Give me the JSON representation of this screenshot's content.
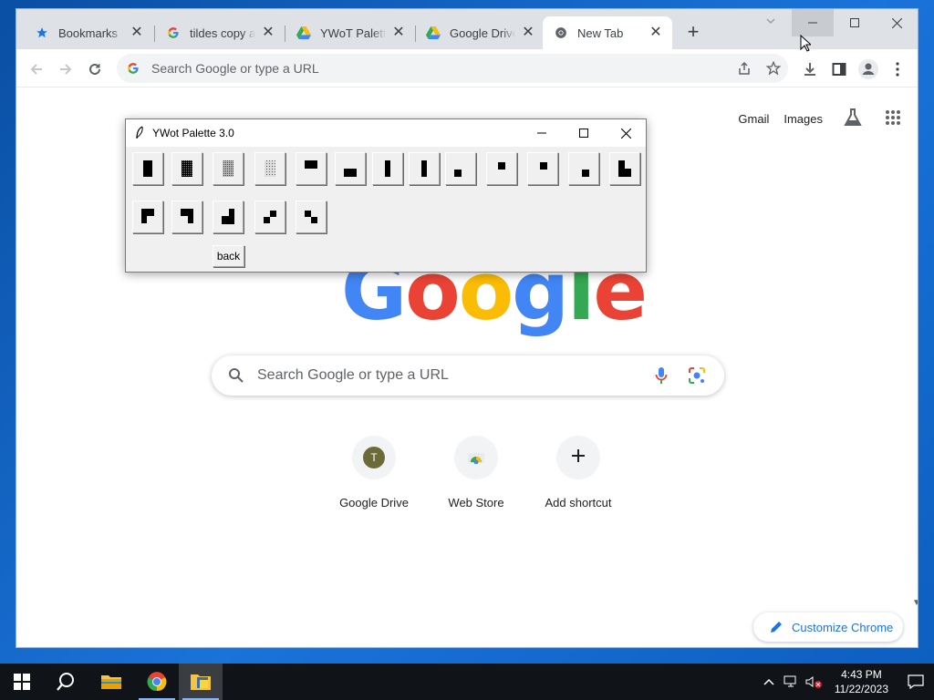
{
  "browser": {
    "tabs": [
      {
        "label": "Bookmarks",
        "icon": "star-icon",
        "active": false
      },
      {
        "label": "tildes copy and",
        "icon": "google-g-icon",
        "active": false
      },
      {
        "label": "YWoT Palette",
        "icon": "google-drive-icon",
        "active": false
      },
      {
        "label": "Google Drive",
        "icon": "google-drive-icon",
        "active": false
      },
      {
        "label": "New Tab",
        "icon": "chrome-icon",
        "active": true
      }
    ],
    "omnibox_placeholder": "Search Google or type a URL"
  },
  "ntp": {
    "gmail_label": "Gmail",
    "images_label": "Images",
    "logo_letters": [
      "G",
      "o",
      "o",
      "g",
      "l",
      "e"
    ],
    "logo_colors": [
      "#4285f4",
      "#ea4335",
      "#fbbc05",
      "#4285f4",
      "#34a853",
      "#ea4335"
    ],
    "search_placeholder": "Search Google or type a URL",
    "shortcuts": [
      {
        "label": "Google Drive",
        "icon_letter": "T",
        "icon_color": "#6b6b3a"
      },
      {
        "label": "Web Store",
        "icon": "web-store-icon"
      },
      {
        "label": "Add shortcut",
        "icon": "plus-icon"
      }
    ],
    "customize_label": "Customize Chrome"
  },
  "palette": {
    "title": "YWot Palette 3.0",
    "row1_glyphs": [
      "full-block",
      "dark-shade",
      "medium-shade",
      "light-shade",
      "upper-half",
      "lower-half",
      "left-bar",
      "right-bar",
      "lower-left-quad",
      "upper-left-quad",
      "upper-right-quad",
      "lower-right-quad",
      "three-quad-l"
    ],
    "row2_glyphs": [
      "three-quad-tl",
      "three-quad-tr",
      "three-quad-br",
      "diagonal-up",
      "diagonal-down"
    ],
    "back_label": "back"
  },
  "taskbar": {
    "time": "4:43 PM",
    "date": "11/22/2023"
  }
}
